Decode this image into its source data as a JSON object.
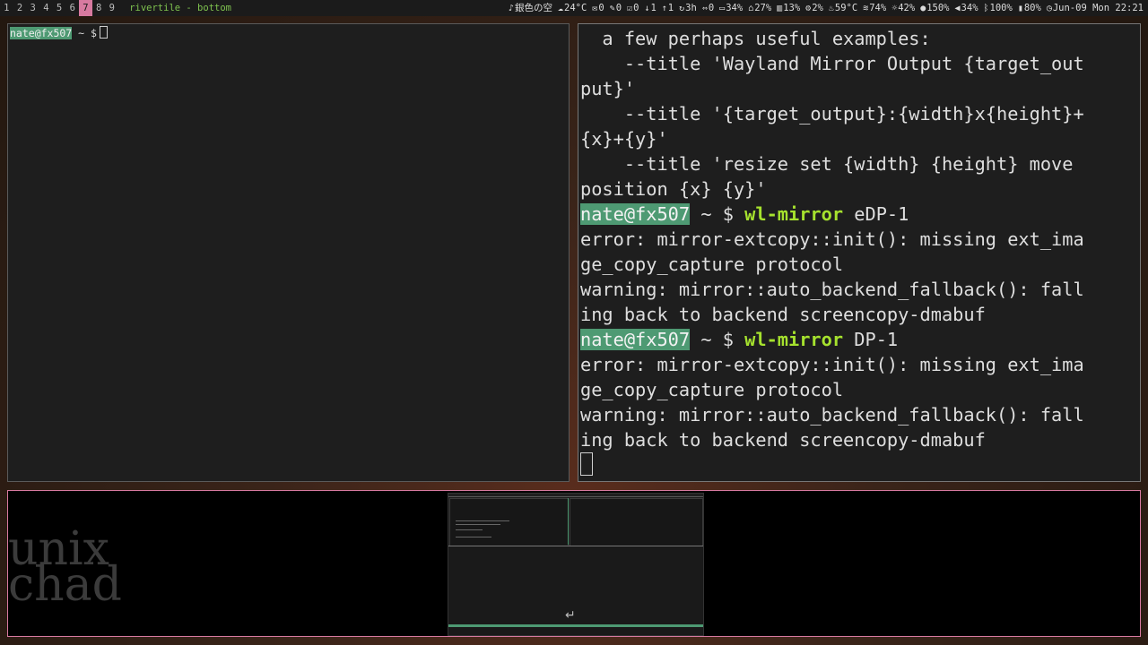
{
  "tags": [
    "1",
    "2",
    "3",
    "4",
    "5",
    "6",
    "7",
    "8",
    "9"
  ],
  "active_tag": "7",
  "window_title": "rivertile - bottom",
  "status": [
    {
      "icon": "music-icon",
      "text": "銀色の空"
    },
    {
      "icon": "cloud-icon",
      "text": "24°C"
    },
    {
      "icon": "mail-icon",
      "text": "0"
    },
    {
      "icon": "chat-icon",
      "text": "0"
    },
    {
      "icon": "checkbox-icon",
      "text": "0"
    },
    {
      "icon": "download-icon",
      "text": "1"
    },
    {
      "icon": "upload-icon",
      "text": "1"
    },
    {
      "icon": "uptime-icon",
      "text": "3h"
    },
    {
      "icon": "usb-icon",
      "text": "0"
    },
    {
      "icon": "folder-icon",
      "text": "34%"
    },
    {
      "icon": "home-icon",
      "text": "27%"
    },
    {
      "icon": "memory-icon",
      "text": "13%"
    },
    {
      "icon": "cpu-icon",
      "text": "2%"
    },
    {
      "icon": "temperature-icon",
      "text": "59°C"
    },
    {
      "icon": "wifi-icon",
      "text": "74%"
    },
    {
      "icon": "brightness-icon",
      "text": "42%"
    },
    {
      "icon": "microphone-icon",
      "text": "150%"
    },
    {
      "icon": "volume-icon",
      "text": "34%"
    },
    {
      "icon": "bluetooth-icon",
      "text": "100%"
    },
    {
      "icon": "battery-icon",
      "text": "80%"
    },
    {
      "icon": "clock-icon",
      "text": "Jun-09 Mon 22:21"
    }
  ],
  "left_terminal": {
    "user": "nate@fx507",
    "rest": " ~ $"
  },
  "right_terminal": {
    "lines": [
      {
        "type": "text",
        "text": "  a few perhaps useful examples:"
      },
      {
        "type": "text",
        "text": "    --title 'Wayland Mirror Output {target_out"
      },
      {
        "type": "text",
        "text": "put}'"
      },
      {
        "type": "text",
        "text": "    --title '{target_output}:{width}x{height}+"
      },
      {
        "type": "text",
        "text": "{x}+{y}'"
      },
      {
        "type": "text",
        "text": "    --title 'resize set {width} {height} move"
      },
      {
        "type": "text",
        "text": "position {x} {y}'"
      },
      {
        "type": "prompt",
        "user": "nate@fx507",
        "path": " ~ $ ",
        "cmd": "wl-mirror",
        "arg": " eDP-1"
      },
      {
        "type": "text",
        "text": "error: mirror-extcopy::init(): missing ext_ima"
      },
      {
        "type": "text",
        "text": "ge_copy_capture protocol"
      },
      {
        "type": "text",
        "text": "warning: mirror::auto_backend_fallback(): fall"
      },
      {
        "type": "text",
        "text": "ing back to backend screencopy-dmabuf"
      },
      {
        "type": "prompt",
        "user": "nate@fx507",
        "path": " ~ $ ",
        "cmd": "wl-mirror",
        "arg": " DP-1"
      },
      {
        "type": "text",
        "text": "error: mirror-extcopy::init(): missing ext_ima"
      },
      {
        "type": "text",
        "text": "ge_copy_capture protocol"
      },
      {
        "type": "text",
        "text": "warning: mirror::auto_backend_fallback(): fall"
      },
      {
        "type": "text",
        "text": "ing back to backend screencopy-dmabuf"
      }
    ]
  },
  "watermark": {
    "line1": "unix",
    "line2": "chad"
  },
  "colors": {
    "accent": "#d87aa0",
    "prompt_bg": "#4e9a73",
    "command": "#a6e22e",
    "title": "#7fc34f"
  }
}
